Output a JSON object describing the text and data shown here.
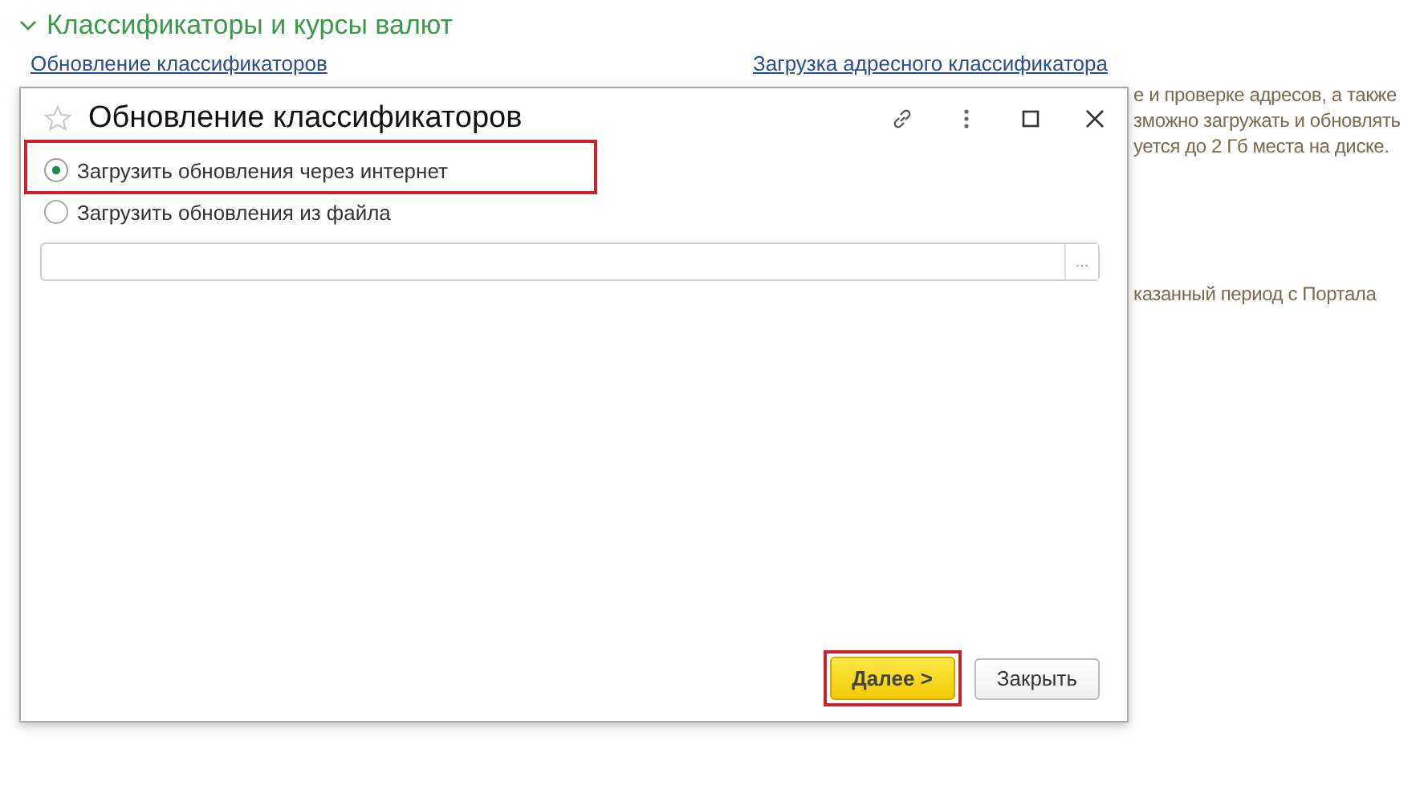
{
  "section": {
    "title": "Классификаторы и курсы валют",
    "expanded": true
  },
  "links": [
    "Обновление классификаторов",
    "Загрузка адресного классификатора"
  ],
  "description_lines": [
    "е и проверке адресов, а также",
    "зможно загружать и обновлять",
    "уется до 2 Гб места на диске.",
    "казанный период с Портала"
  ],
  "dialog": {
    "title": "Обновление классификаторов",
    "options": [
      {
        "label": "Загрузить обновления через интернет",
        "selected": true,
        "highlighted": true
      },
      {
        "label": "Загрузить обновления из файла",
        "selected": false,
        "highlighted": false
      }
    ],
    "file_field": {
      "button": "..."
    },
    "buttons": [
      {
        "label": "Далее >",
        "kind": "default",
        "highlighted": true
      },
      {
        "label": "Закрыть",
        "kind": "normal",
        "highlighted": false
      }
    ]
  }
}
